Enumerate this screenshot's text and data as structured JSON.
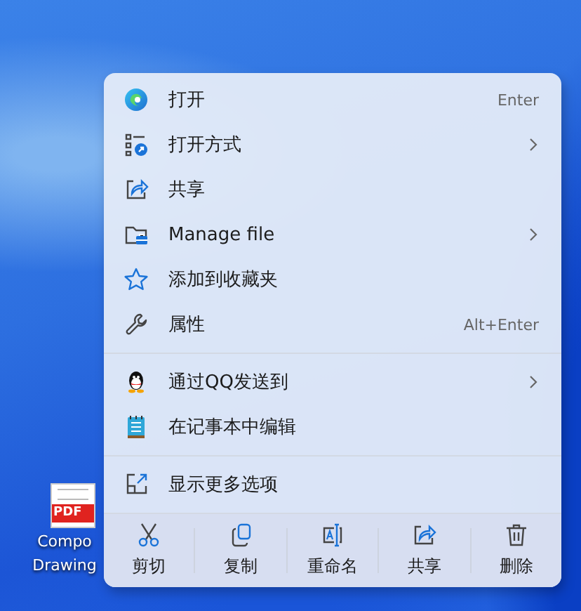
{
  "desktop_icon": {
    "badge": "PDF",
    "label_lines": [
      "Compo",
      "Drawing"
    ]
  },
  "menu": {
    "groups": [
      [
        {
          "label": "打开",
          "shortcut": "Enter",
          "submenu": false
        },
        {
          "label": "打开方式",
          "submenu": true
        },
        {
          "label": "共享",
          "submenu": false
        },
        {
          "label": "Manage file",
          "submenu": true
        },
        {
          "label": "添加到收藏夹",
          "submenu": false
        },
        {
          "label": "属性",
          "shortcut": "Alt+Enter",
          "submenu": false
        }
      ],
      [
        {
          "label": "通过QQ发送到",
          "submenu": true
        },
        {
          "label": "在记事本中编辑",
          "submenu": false
        }
      ],
      [
        {
          "label": "显示更多选项",
          "submenu": false
        }
      ]
    ],
    "toolbar": [
      {
        "label": "剪切"
      },
      {
        "label": "复制"
      },
      {
        "label": "重命名"
      },
      {
        "label": "共享"
      },
      {
        "label": "删除"
      }
    ]
  }
}
